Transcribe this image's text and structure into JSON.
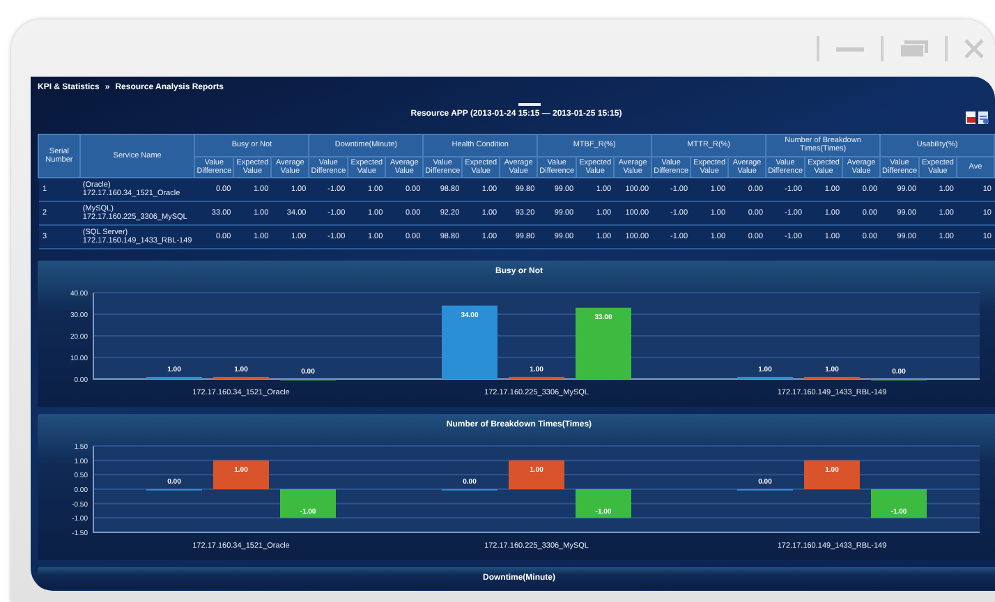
{
  "breadcrumb": {
    "items": [
      "KPI & Statistics",
      "Resource Analysis Reports"
    ],
    "separator": "»"
  },
  "report_title": "Resource APP (2013-01-24 15:15 — 2013-01-25 15:15)",
  "table": {
    "columns": [
      {
        "label": "Serial Number"
      },
      {
        "label": "Service Name"
      },
      {
        "label": "Busy or Not",
        "sub": [
          "Value Difference",
          "Expected Value",
          "Average Value"
        ]
      },
      {
        "label": "Downtime(Minute)",
        "sub": [
          "Value Difference",
          "Expected Value",
          "Average Value"
        ]
      },
      {
        "label": "Health Condition",
        "sub": [
          "Value Difference",
          "Expected Value",
          "Average Value"
        ]
      },
      {
        "label": "MTBF_R(%)",
        "sub": [
          "Value Difference",
          "Expected Value",
          "Average Value"
        ]
      },
      {
        "label": "MTTR_R(%)",
        "sub": [
          "Value Difference",
          "Expected Value",
          "Average Value"
        ]
      },
      {
        "label": "Number of Breakdown Times(Times)",
        "sub": [
          "Value Difference",
          "Expected Value",
          "Average Value"
        ]
      },
      {
        "label": "Usability(%)",
        "sub": [
          "Value Difference",
          "Expected Value",
          "Ave"
        ]
      }
    ],
    "rows": [
      {
        "serial": "1",
        "service_type": "(Oracle)",
        "service_host": "172.17.160.34_1521_Oracle",
        "values": [
          "0.00",
          "1.00",
          "1.00",
          "-1.00",
          "1.00",
          "0.00",
          "98.80",
          "1.00",
          "99.80",
          "99.00",
          "1.00",
          "100.00",
          "-1.00",
          "1.00",
          "0.00",
          "-1.00",
          "1.00",
          "0.00",
          "99.00",
          "1.00",
          "10"
        ]
      },
      {
        "serial": "2",
        "service_type": "(MySQL)",
        "service_host": "172.17.160.225_3306_MySQL",
        "values": [
          "33.00",
          "1.00",
          "34.00",
          "-1.00",
          "1.00",
          "0.00",
          "92.20",
          "1.00",
          "93.20",
          "99.00",
          "1.00",
          "100.00",
          "-1.00",
          "1.00",
          "0.00",
          "-1.00",
          "1.00",
          "0.00",
          "99.00",
          "1.00",
          "10"
        ]
      },
      {
        "serial": "3",
        "service_type": "(SQL Server)",
        "service_host": "172.17.160.149_1433_RBL-149",
        "values": [
          "0.00",
          "1.00",
          "1.00",
          "-1.00",
          "1.00",
          "0.00",
          "98.80",
          "1.00",
          "99.80",
          "99.00",
          "1.00",
          "100.00",
          "-1.00",
          "1.00",
          "0.00",
          "-1.00",
          "1.00",
          "0.00",
          "99.00",
          "1.00",
          "10"
        ]
      }
    ]
  },
  "charts": [
    {
      "title": "Busy or Not",
      "chart_data": {
        "type": "bar",
        "categories": [
          "172.17.160.34_1521_Oracle",
          "172.17.160.225_3306_MySQL",
          "172.17.160.149_1433_RBL-149"
        ],
        "series": [
          {
            "color": "#2a8fd6",
            "values": [
              1,
              34,
              1
            ],
            "value_labels": [
              "1.00",
              "34.00",
              "1.00"
            ]
          },
          {
            "color": "#d9542b",
            "values": [
              1,
              1,
              1
            ],
            "value_labels": [
              "1.00",
              "1.00",
              "1.00"
            ]
          },
          {
            "color": "#3cbb40",
            "values": [
              0,
              33,
              0
            ],
            "value_labels": [
              "0.00",
              "33.00",
              "0.00"
            ]
          }
        ],
        "ylim": [
          0,
          40
        ],
        "yticks": [
          {
            "value": 0,
            "label": "0.00"
          },
          {
            "value": 10,
            "label": "10.00"
          },
          {
            "value": 20,
            "label": "20.00"
          },
          {
            "value": 30,
            "label": "30.00"
          },
          {
            "value": 40,
            "label": "40.00"
          }
        ],
        "grid": true,
        "data_labels": true
      }
    },
    {
      "title": "Number of Breakdown Times(Times)",
      "chart_data": {
        "type": "bar",
        "categories": [
          "172.17.160.34_1521_Oracle",
          "172.17.160.225_3306_MySQL",
          "172.17.160.149_1433_RBL-149"
        ],
        "series": [
          {
            "color": "#2a8fd6",
            "values": [
              0,
              0,
              0
            ],
            "value_labels": [
              "0.00",
              "0.00",
              "0.00"
            ]
          },
          {
            "color": "#d9542b",
            "values": [
              1,
              1,
              1
            ],
            "value_labels": [
              "1.00",
              "1.00",
              "1.00"
            ]
          },
          {
            "color": "#3cbb40",
            "values": [
              -1,
              -1,
              -1
            ],
            "value_labels": [
              "-1.00",
              "-1.00",
              "-1.00"
            ]
          }
        ],
        "ylim": [
          -1.5,
          1.5
        ],
        "yticks": [
          {
            "value": -1.5,
            "label": "-1.50"
          },
          {
            "value": -1,
            "label": "-1.00"
          },
          {
            "value": -0.5,
            "label": "-0.50"
          },
          {
            "value": 0,
            "label": "0.00"
          },
          {
            "value": 0.5,
            "label": "0.50"
          },
          {
            "value": 1,
            "label": "1.00"
          },
          {
            "value": 1.5,
            "label": "1.50"
          }
        ],
        "grid": true,
        "data_labels": true
      }
    },
    {
      "title": "Downtime(Minute)"
    }
  ]
}
